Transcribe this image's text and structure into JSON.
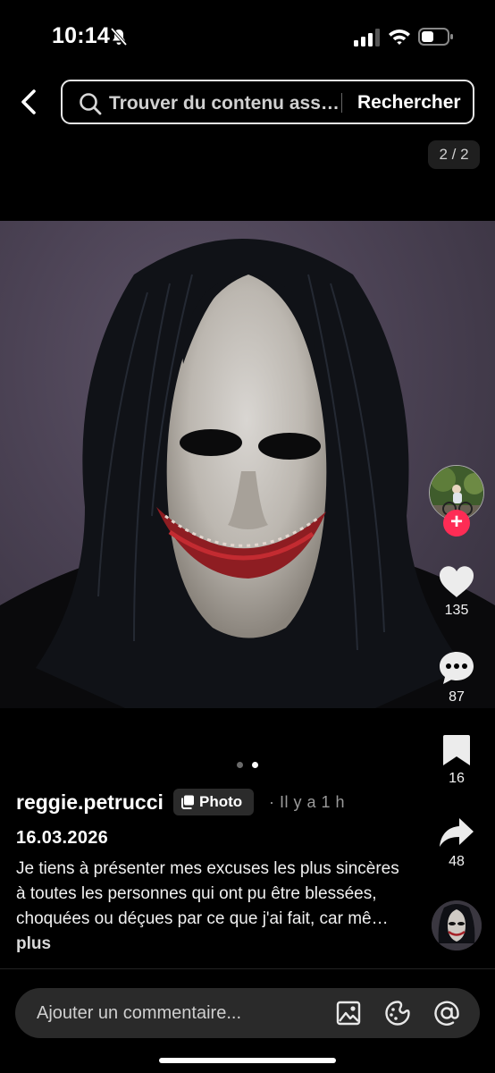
{
  "status_bar": {
    "time": "10:14"
  },
  "search": {
    "placeholder": "Trouver du contenu ass…",
    "button_label": "Rechercher"
  },
  "page_counter": "2 / 2",
  "carousel": {
    "total": 2,
    "active_index": 1
  },
  "post": {
    "author": "reggie.petrucci",
    "type_badge": "Photo",
    "time_ago": "· Il y a 1 h",
    "date": "16.03.2026",
    "caption": "Je tiens à présenter mes excuses les plus sincères à toutes les personnes qui ont pu être blessées, choquées ou déçues par ce que j'ai fait, car mê…",
    "more_label": "plus"
  },
  "actions": {
    "likes": "135",
    "comments": "87",
    "saves": "16",
    "shares": "48",
    "follow_label": "+"
  },
  "comment_bar": {
    "placeholder": "Ajouter un commentaire..."
  },
  "colors": {
    "background": "#000000",
    "follow_accent": "#fe2c55",
    "comment_bar": "#2a2a2a"
  },
  "icons": [
    "bell-slash-icon",
    "signal-icon",
    "wifi-icon",
    "battery-icon",
    "back-chevron-icon",
    "search-icon",
    "heart-icon",
    "comment-icon",
    "bookmark-icon",
    "share-icon",
    "image-icon",
    "sticker-icon",
    "mention-icon"
  ]
}
